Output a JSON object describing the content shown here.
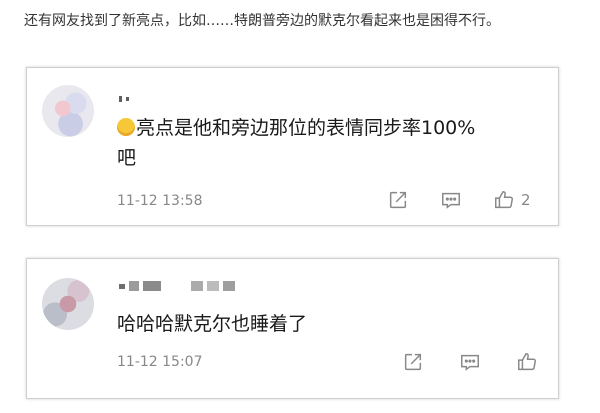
{
  "intro_text": "还有网友找到了新亮点，比如……特朗普旁边的默克尔看起来也是困得不行。",
  "comments": [
    {
      "text_line1": "亮点是他和旁边那位的表情同步率100%",
      "text_line2": "吧",
      "emoji": "sweat-laugh-emoji",
      "time": "11-12 13:58",
      "like_count": "2"
    },
    {
      "text_line1": "哈哈哈默克尔也睡着了",
      "time": "11-12 15:07",
      "like_count": ""
    }
  ],
  "icons": [
    "share-icon",
    "comment-icon",
    "like-icon"
  ],
  "colors": {
    "border": "#cfcfcf",
    "meta_text": "#888888",
    "icon": "#888888"
  }
}
